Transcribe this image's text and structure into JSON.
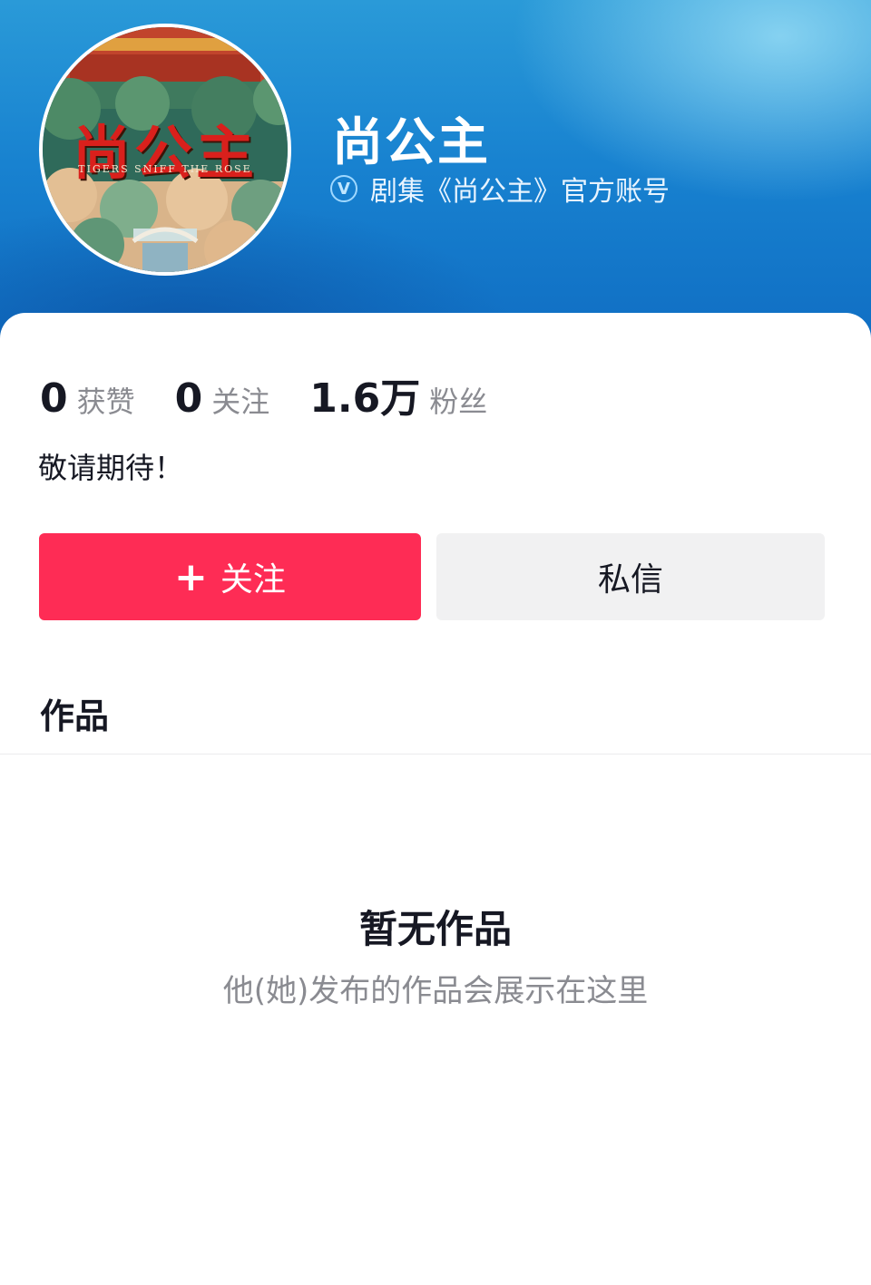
{
  "profile": {
    "avatar_title": "尚公主",
    "avatar_subtitle": "TIGERS SNIFF THE ROSE",
    "nickname": "尚公主",
    "verify_badge": "V",
    "verify_text": "剧集《尚公主》官方账号"
  },
  "stats": [
    {
      "value": "0",
      "label": "获赞"
    },
    {
      "value": "0",
      "label": "关注"
    },
    {
      "value": "1.6万",
      "label": "粉丝"
    }
  ],
  "bio": "敬请期待！",
  "actions": {
    "follow_plus": "+",
    "follow_label": "关注",
    "message_label": "私信"
  },
  "tabs": {
    "works": "作品"
  },
  "empty": {
    "title": "暂无作品",
    "subtitle": "他(她)发布的作品会展示在这里"
  },
  "colors": {
    "accent": "#fe2c55",
    "header_blue": "#1882d0",
    "secondary_button": "#f1f1f2"
  }
}
